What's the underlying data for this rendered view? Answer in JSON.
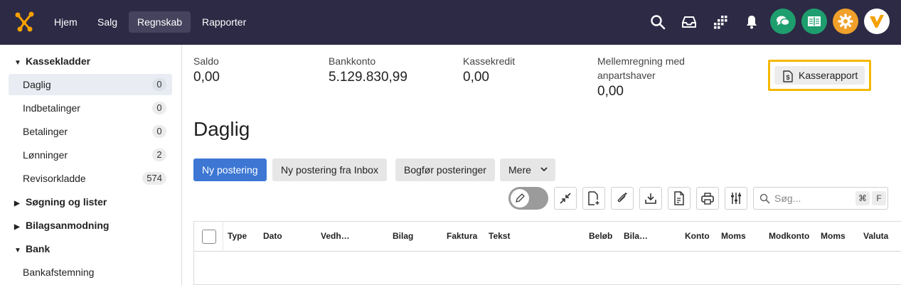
{
  "nav": {
    "items": [
      "Hjem",
      "Salg",
      "Regnskab",
      "Rapporter"
    ],
    "active": "Regnskab"
  },
  "topbar_icons": {
    "search": "search-icon",
    "inbox": "inbox-icon",
    "apps": "apps-grid-icon",
    "notifications": "bell-icon",
    "chat": "chat-icon",
    "guide": "book-icon",
    "settings": "gear-icon",
    "avatar": "avatar",
    "colors": {
      "chat": "#1e9e6e",
      "guide": "#1e9e6e",
      "settings": "#f0a02a",
      "avatar_mark": "#f5a000"
    }
  },
  "sidebar": {
    "sections": [
      {
        "title": "Kassekladder",
        "expanded": true,
        "items": [
          {
            "label": "Daglig",
            "count": "0",
            "active": true
          },
          {
            "label": "Indbetalinger",
            "count": "0"
          },
          {
            "label": "Betalinger",
            "count": "0"
          },
          {
            "label": "Lønninger",
            "count": "2"
          },
          {
            "label": "Revisorkladde",
            "count": "574"
          }
        ]
      },
      {
        "title": "Søgning og lister",
        "expanded": false
      },
      {
        "title": "Bilagsanmodning",
        "expanded": false
      },
      {
        "title": "Bank",
        "expanded": true,
        "items": [
          {
            "label": "Bankafstemning"
          }
        ]
      }
    ]
  },
  "summary": [
    {
      "label": "Saldo",
      "value": "0,00"
    },
    {
      "label": "Bankkonto",
      "value": "5.129.830,99"
    },
    {
      "label": "Kassekredit",
      "value": "0,00"
    },
    {
      "label": "Mellemregning med anpartshaver",
      "value": "0,00"
    }
  ],
  "kasserapport_label": "Kasserapport",
  "page_title": "Daglig",
  "actions": {
    "new": "Ny postering",
    "new_from_inbox": "Ny postering fra Inbox",
    "book": "Bogfør posteringer",
    "more": "Mere"
  },
  "toolbar": {
    "search_placeholder": "Søg...",
    "shortcut_keys": [
      "⌘",
      "F"
    ]
  },
  "table": {
    "columns": [
      "Type",
      "Dato",
      "Vedh…",
      "Bilag",
      "Faktura",
      "Tekst",
      "Beløb",
      "Bila…",
      "Konto",
      "Moms",
      "Modkonto",
      "Moms",
      "Valuta"
    ]
  }
}
